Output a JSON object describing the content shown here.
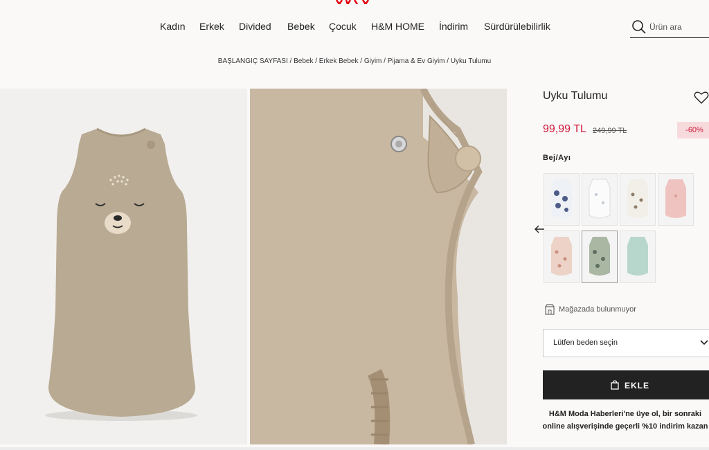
{
  "nav": {
    "items": [
      "Kadın",
      "Erkek",
      "Divided",
      "Bebek",
      "Çocuk",
      "H&M HOME",
      "İndirim",
      "Sürdürülebilirlik"
    ]
  },
  "search": {
    "placeholder": "Ürün ara"
  },
  "breadcrumb": "BAŞLANGIÇ SAYFASI / Bebek / Erkek Bebek / Giyim / Pijama & Ev Giyim / Uyku Tulumu",
  "product": {
    "title": "Uyku Tulumu",
    "price": "99,99 TL",
    "old_price": "249,99 TL",
    "discount": "-60%",
    "color_label": "Bej/Ayı"
  },
  "store": {
    "text": "Mağazada bulunmuyor"
  },
  "size_select": {
    "placeholder": "Lütfen beden seçin"
  },
  "add_button": {
    "label": "EKLE"
  },
  "promo": {
    "line1": "H&M Moda Haberleri'ne üye ol, bir sonraki",
    "line2": "online alışverişinde geçerli %10 indirim kazan"
  },
  "colors": {
    "accent": "#d1173a",
    "button": "#222222",
    "garment": "#c4b29b"
  },
  "icons": [
    "search-icon",
    "heart-icon",
    "arrow-left-icon",
    "store-icon",
    "chevron-down-icon",
    "bag-icon"
  ]
}
